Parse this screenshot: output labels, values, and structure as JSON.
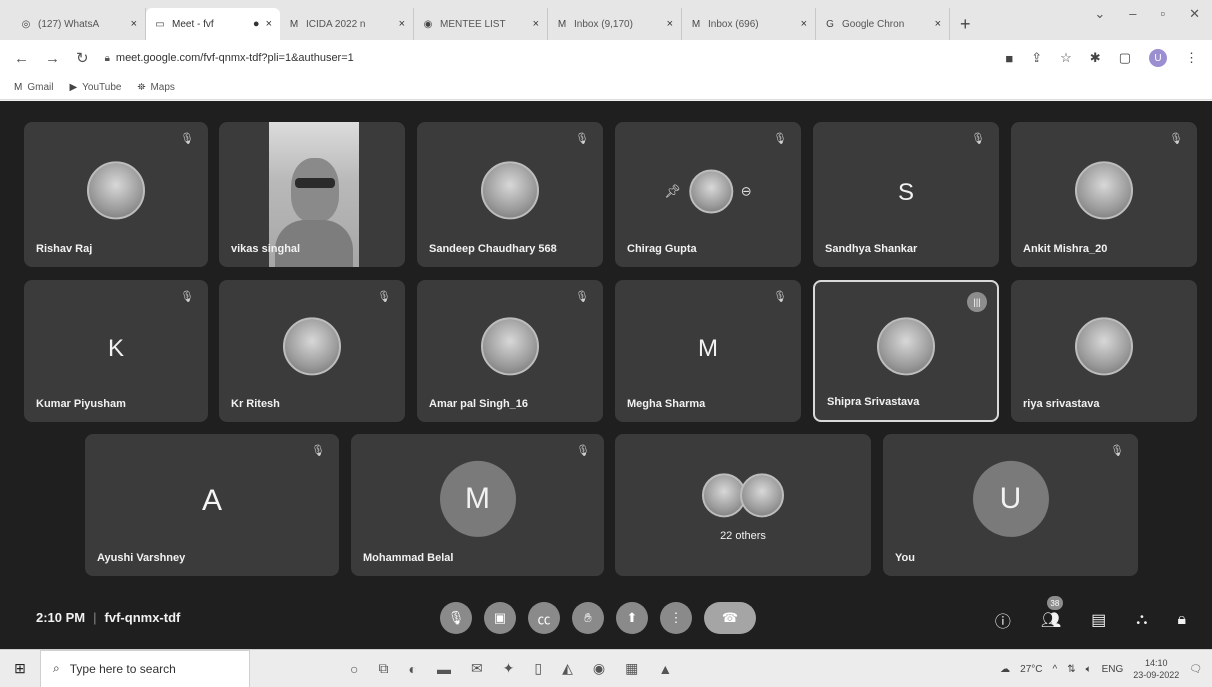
{
  "tabs": [
    {
      "label": "(127) WhatsA",
      "icon": "whatsapp-icon",
      "active": false
    },
    {
      "label": "Meet - fvf",
      "icon": "meet-icon",
      "active": true
    },
    {
      "label": "ICIDA 2022 n",
      "icon": "gmail-icon",
      "active": false
    },
    {
      "label": "MENTEE LIST",
      "icon": "drive-icon",
      "active": false
    },
    {
      "label": "Inbox (9,170)",
      "icon": "gmail-icon",
      "active": false
    },
    {
      "label": "Inbox (696)",
      "icon": "gmail-icon",
      "active": false
    },
    {
      "label": "Google Chron",
      "icon": "google-icon",
      "active": false
    }
  ],
  "address": {
    "url": "meet.google.com/fvf-qnmx-tdf?pli=1&authuser=1"
  },
  "profile_initial": "U",
  "bookmarks": [
    {
      "label": "Gmail",
      "icon": "M"
    },
    {
      "label": "YouTube",
      "icon": "▶"
    },
    {
      "label": "Maps",
      "icon": "⛯"
    }
  ],
  "participants": {
    "rishav": {
      "name": "Rishav Raj"
    },
    "vikas": {
      "name": "vikas singhal"
    },
    "sandeep": {
      "name": "Sandeep Chaudhary 568"
    },
    "chirag": {
      "name": "Chirag Gupta"
    },
    "sandhya": {
      "name": "Sandhya Shankar",
      "initial": "S"
    },
    "ankit": {
      "name": "Ankit Mishra_20"
    },
    "kumar": {
      "name": "Kumar Piyusham",
      "initial": "K"
    },
    "ritesh": {
      "name": "Kr Ritesh"
    },
    "amar": {
      "name": "Amar pal Singh_16"
    },
    "megha": {
      "name": "Megha Sharma",
      "initial": "M"
    },
    "shipra": {
      "name": "Shipra Srivastava"
    },
    "riya": {
      "name": "riya srivastava"
    },
    "ayushi": {
      "name": "Ayushi Varshney",
      "initial": "A"
    },
    "mohammad": {
      "name": "Mohammad Belal",
      "initial": "M"
    },
    "others": {
      "label": "22 others"
    },
    "you": {
      "name": "You",
      "initial": "U"
    }
  },
  "meeting": {
    "time": "2:10 PM",
    "code": "fvf-qnmx-tdf",
    "people_count": "38"
  },
  "taskbar": {
    "search_placeholder": "Type here to search",
    "weather": "27°C",
    "lang": "ENG",
    "time": "14:10",
    "date": "23-09-2022"
  }
}
